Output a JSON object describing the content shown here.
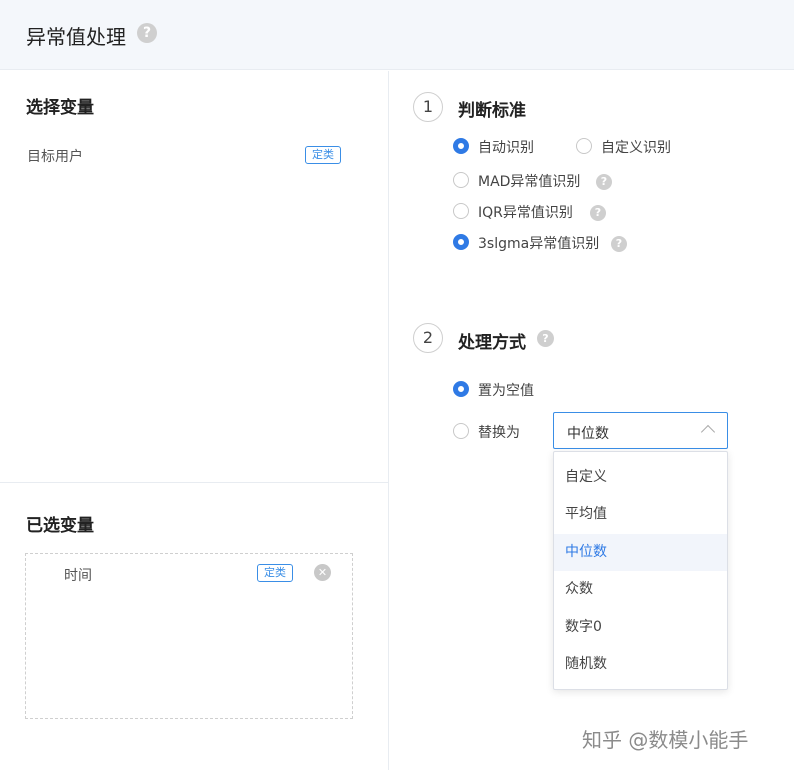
{
  "header": {
    "title": "异常值处理"
  },
  "variables": {
    "title": "选择变量",
    "items": [
      {
        "name": "目标用户",
        "tag": "定类"
      }
    ]
  },
  "selected": {
    "title": "已选变量",
    "items": [
      {
        "name": "时间",
        "tag": "定类"
      }
    ]
  },
  "criteria": {
    "step": "1",
    "title": "判断标准",
    "options": [
      {
        "label": "自动识别",
        "checked": true
      },
      {
        "label": "自定义识别",
        "checked": false
      },
      {
        "label": "MAD异常值识别",
        "checked": false
      },
      {
        "label": "IQR异常值识别",
        "checked": false
      },
      {
        "label": "3slgma异常值识别",
        "checked": true
      }
    ]
  },
  "handling": {
    "step": "2",
    "title": "处理方式",
    "options": [
      {
        "label": "置为空值",
        "checked": true
      },
      {
        "label": "替换为",
        "checked": false
      }
    ],
    "select_value": "中位数",
    "dropdown": [
      "自定义",
      "平均值",
      "中位数",
      "众数",
      "数字0",
      "随机数"
    ],
    "dropdown_active": "中位数"
  },
  "watermark": "知乎 @数模小能手",
  "colors": {
    "accent": "#2f7ae5",
    "tag": "#3a8ee6",
    "header_bg": "#f4f7fb"
  }
}
